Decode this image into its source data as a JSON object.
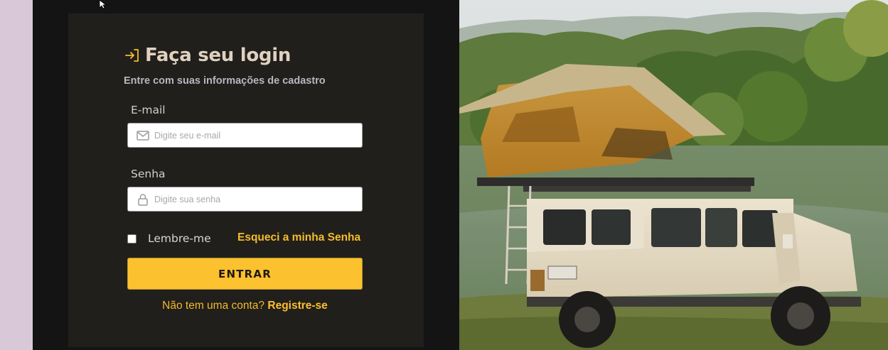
{
  "colors": {
    "accent": "#fcc12f",
    "link": "#f5bd2c",
    "panel": "#211f1c",
    "frame": "#141414",
    "title": "#e0d1bf"
  },
  "login": {
    "title": "Faça seu login",
    "title_icon": "login-arrow-icon",
    "subtitle": "Entre com suas informações de cadastro",
    "email": {
      "label": "E-mail",
      "placeholder": "Digite seu e-mail",
      "value": "",
      "icon": "mail-icon"
    },
    "password": {
      "label": "Senha",
      "placeholder": "Digite sua senha",
      "value": "",
      "icon": "lock-icon"
    },
    "remember_label": "Lembre-me",
    "remember_checked": false,
    "forgot_label": "Esqueci a minha Senha",
    "submit_label": "ENTRAR",
    "register_prompt": "Não tem uma conta?",
    "register_link": "Registre-se"
  },
  "hero": {
    "subject": "4x4 vehicle with rooftop tent by a lake"
  }
}
